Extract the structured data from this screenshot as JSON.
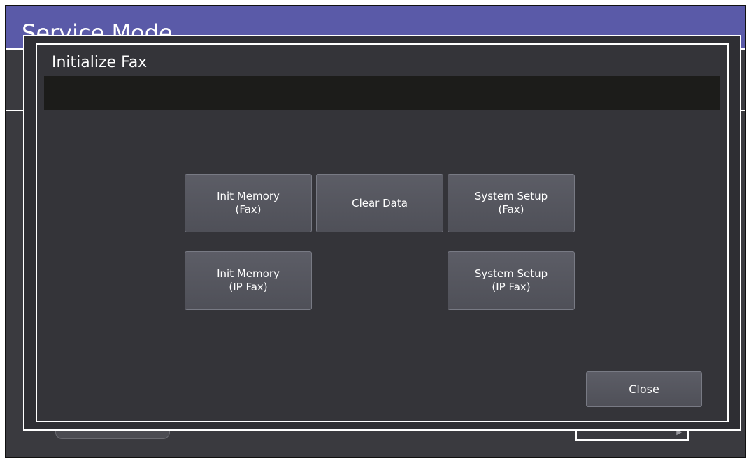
{
  "screen": {
    "title": "Service Mode"
  },
  "dialog": {
    "title": "Initialize Fax",
    "message": "",
    "buttons": {
      "init_memory_fax": {
        "line1": "Init Memory",
        "line2": "(Fax)"
      },
      "clear_data": {
        "line1": "Clear Data"
      },
      "system_setup_fax": {
        "line1": "System Setup",
        "line2": "(Fax)"
      },
      "init_memory_ip_fax": {
        "line1": "Init Memory",
        "line2": "(IP Fax)"
      },
      "system_setup_ip_fax": {
        "line1": "System Setup",
        "line2": "(IP Fax)"
      }
    },
    "close_label": "Close"
  },
  "colors": {
    "title_bar": "#5a5aa8",
    "background": "#3a3a3f",
    "button": "#55565e",
    "message_bar": "#1c1c1a"
  }
}
